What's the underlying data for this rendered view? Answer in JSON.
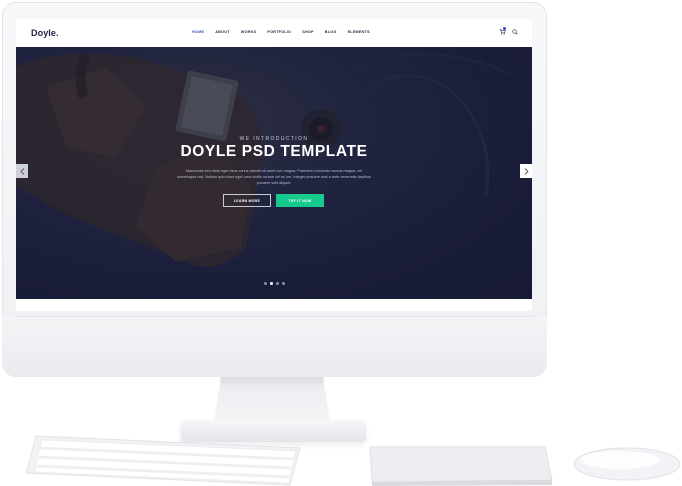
{
  "nav": {
    "logo_icon": "D",
    "logo_text": "oyle.",
    "items": [
      "HOME",
      "ABOUT",
      "WORKS",
      "PORTFOLIO",
      "SHOP",
      "BLOG",
      "ELEMENTS"
    ],
    "active_index": 0
  },
  "hero": {
    "subtitle": "WE INTRODUCTION",
    "title": "DOYLE PSD TEMPLATE",
    "description": "Maecenas sed diam eget risus varius blandit sit amet non magna. Praesent commodo cursus magna, vel scelerisque nisl. Nullam quis risus eget urna mollis ornare vel eu leo. Integer posuere erat a ante venenatis dapibus posuere velit aliquet.",
    "primary_button": "LEARN MORE",
    "secondary_button": "TRY IT NOW",
    "slides": 4,
    "active_slide": 1
  },
  "colors": {
    "accent": "#3a4cc7",
    "cta_green": "#16c98d",
    "hero_bg": "#1c1f3b"
  },
  "icons": {
    "cart": "cart-icon",
    "search": "search-icon",
    "prev": "chevron-left-icon",
    "next": "chevron-right-icon"
  }
}
